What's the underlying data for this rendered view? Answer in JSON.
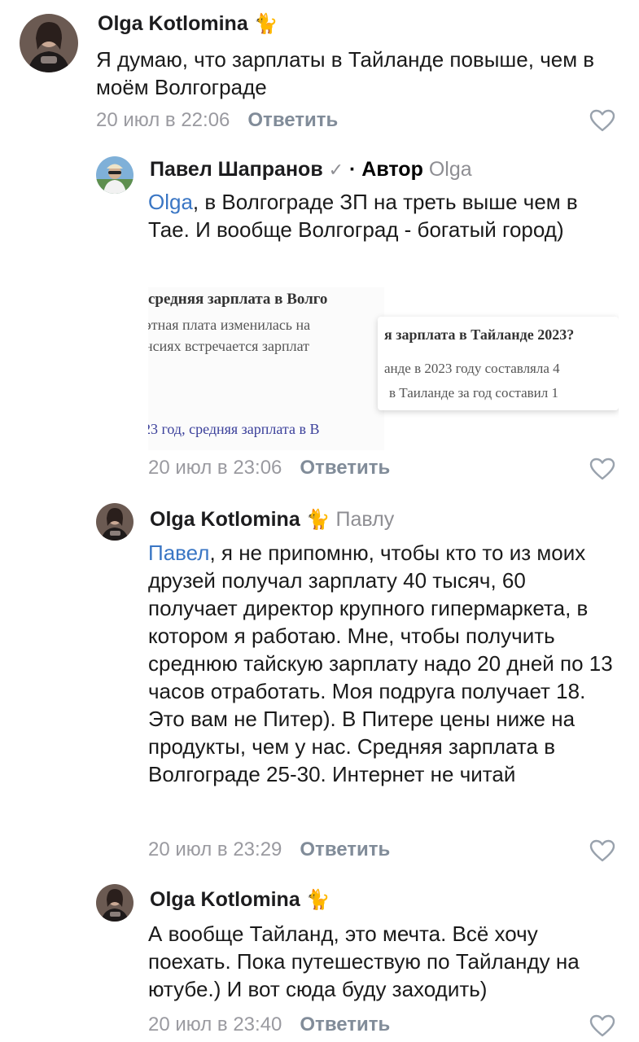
{
  "comments": [
    {
      "author": "Olga Kotlomina",
      "badge": "🐈",
      "text": "Я думаю, что зарплаты в Тайланде повыше, чем в моём Волгограде",
      "time": "20 июл в 22:06",
      "reply_label": "Ответить"
    },
    {
      "author": "Павел Шапранов",
      "verified_mark": "✓",
      "author_tag": "· Автор",
      "reply_to": "Olga",
      "mention": "Olga",
      "text": ", в Волгограде ЗП на треть выше чем в Тае. И вообще Волгоград - богатый город)",
      "attachment": {
        "left_heading": "средняя зарплата в Волго",
        "left_line1": "этная плата изменилась на",
        "left_line2": "нсиях встречается зарплат",
        "left_line3": "23 год, средняя зарплата в В",
        "right_heading": "я зарплата в Тайланде 2023?",
        "right_line1": "анде в 2023 году составляла 4",
        "right_line2": "в Таиланде за год составил 1"
      },
      "time": "20 июл в 23:06",
      "reply_label": "Ответить"
    },
    {
      "author": "Olga Kotlomina",
      "badge": "🐈",
      "reply_to": "Павлу",
      "mention": "Павел",
      "text": ", я не припомню, чтобы кто то из моих друзей получал зарплату 40 тысяч, 60 получает директор крупного гипермаркета, в котором я работаю. Мне, чтобы получить среднюю тайскую зарплату надо 20 дней по 13 часов отработать. Моя подруга получает 18. Это вам не Питер). В Питере цены ниже на продукты, чем у нас. Средняя зарплата в Волгограде 25-30. Интернет не читай",
      "time": "20 июл в 23:29",
      "reply_label": "Ответить"
    },
    {
      "author": "Olga Kotlomina",
      "badge": "🐈",
      "text": "А вообще Тайланд, это мечта. Всё хочу поехать. Пока путешествую по Тайланду на ютубе.) И вот сюда буду заходить)",
      "time": "20 июл в 23:40",
      "reply_label": "Ответить"
    }
  ],
  "icons": {
    "heart": "heart-outline-icon",
    "avatar_olga": "olga-avatar",
    "avatar_pavel": "pavel-avatar"
  },
  "colors": {
    "mention": "#3a76c4",
    "meta": "#9a9aa0",
    "reply": "#818c99",
    "heart": "#99a2ad"
  }
}
